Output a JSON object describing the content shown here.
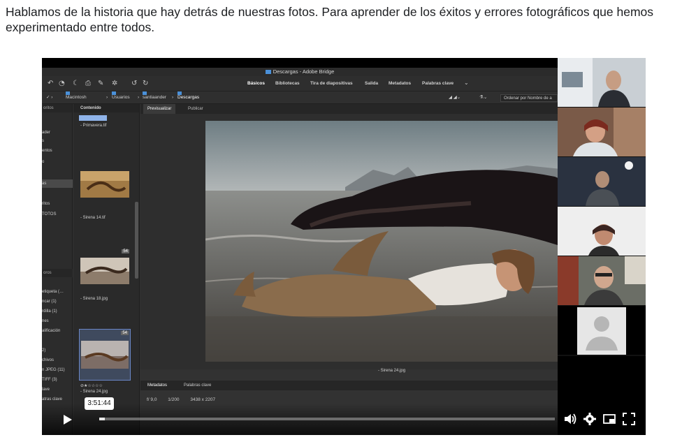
{
  "page": {
    "intro_text": "Hablamos de la historia que hay detrás de nuestras fotos. Para aprender de los éxitos y errores fotográficos que hemos experimentado entre todos."
  },
  "bridge": {
    "window_title": "Descargas - Adobe Bridge",
    "workspaces": [
      "Básicos",
      "Bibliotecas",
      "Tira de diapositivas",
      "Salida",
      "Metadatos",
      "Palabras clave"
    ],
    "active_workspace": "Básicos",
    "path": [
      "Macintosh HD",
      "Usuarios",
      "santiaander",
      "Descargas"
    ],
    "sort_label": "Ordenar por Nombre de a",
    "left_panel": {
      "tab": "oritos",
      "items": [
        "ader",
        "s",
        "entos",
        "o",
        "as",
        "ritos",
        "TOTOS"
      ],
      "lower_tab": "oros",
      "lower_items": [
        "etiqueta (…",
        "ncar (1)",
        "rdilla (1)",
        "nes",
        "alificación",
        "",
        "2)",
        "chivos",
        "n JPEG (11)",
        "TIFF (3)",
        "lave",
        "atras clave"
      ]
    },
    "content_panel": {
      "tab": "Contenido",
      "items": [
        {
          "name": "Primavera.tif"
        },
        {
          "name": "Sirena 14.tif"
        },
        {
          "name": "Sirena 18.jpg",
          "badge": "54"
        },
        {
          "name": "Sirena 24.jpg",
          "badge": "54",
          "selected": true,
          "rating_text": "⊘★☆☆☆☆"
        }
      ]
    },
    "preview_tabs": [
      "Previsualizar",
      "Publicar"
    ],
    "preview_caption": "Sirena 24.jpg",
    "meta_tabs": [
      "Metadatos",
      "Palabras clave"
    ],
    "meta_info": {
      "aperture": "f/ 9,0",
      "shutter": "1/200",
      "dimensions": "3438 x 2207"
    }
  },
  "participants": [
    {
      "name": "participant-1"
    },
    {
      "name": "participant-2"
    },
    {
      "name": "participant-3"
    },
    {
      "name": "participant-4"
    },
    {
      "name": "participant-5"
    },
    {
      "name": "participant-6-placeholder"
    }
  ],
  "player": {
    "time_tooltip": "3:51:44",
    "progress": 0.012,
    "icons": [
      "play-icon",
      "volume-icon",
      "settings-icon",
      "pip-icon",
      "fullscreen-icon"
    ]
  },
  "colors": {
    "accent_blue": "#4a90d9",
    "bridge_bg": "#323232",
    "tooltip_bg": "#ffffff"
  }
}
